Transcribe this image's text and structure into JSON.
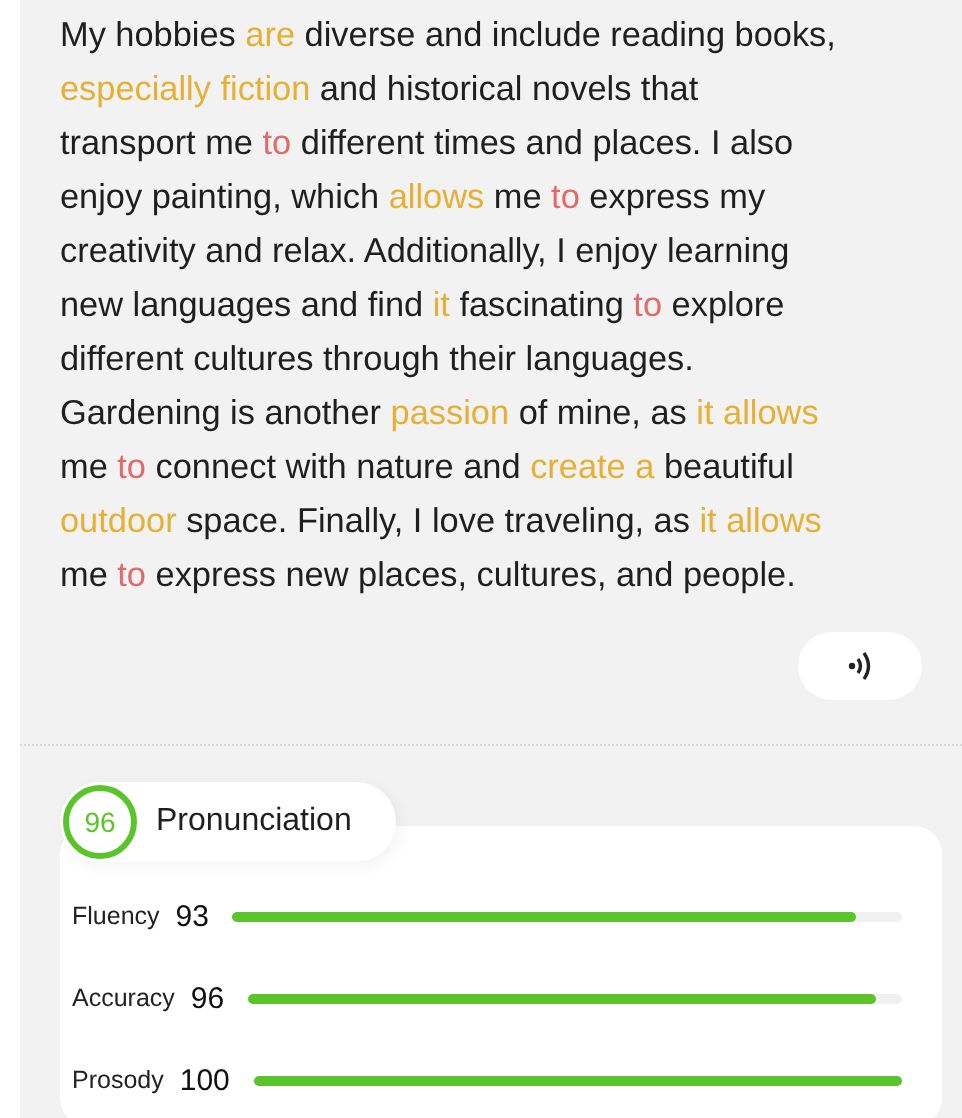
{
  "passage": {
    "lines": [
      [
        {
          "text": "My hobbies ",
          "kind": "plain"
        },
        {
          "text": "are",
          "kind": "minor"
        },
        {
          "text": " diverse and include reading books,",
          "kind": "plain"
        }
      ],
      [
        {
          "text": "especially fiction",
          "kind": "minor"
        },
        {
          "text": " and historical novels that",
          "kind": "plain"
        }
      ],
      [
        {
          "text": "transport me ",
          "kind": "plain"
        },
        {
          "text": "to",
          "kind": "major"
        },
        {
          "text": " different times and places. I also",
          "kind": "plain"
        }
      ],
      [
        {
          "text": "enjoy painting, which ",
          "kind": "plain"
        },
        {
          "text": "allows",
          "kind": "minor"
        },
        {
          "text": " me ",
          "kind": "plain"
        },
        {
          "text": "to",
          "kind": "major"
        },
        {
          "text": " express my",
          "kind": "plain"
        }
      ],
      [
        {
          "text": "creativity and relax. Additionally, I enjoy learning",
          "kind": "plain"
        }
      ],
      [
        {
          "text": "new languages and find ",
          "kind": "plain"
        },
        {
          "text": "it",
          "kind": "minor"
        },
        {
          "text": " fascinating ",
          "kind": "plain"
        },
        {
          "text": "to",
          "kind": "major"
        },
        {
          "text": " explore",
          "kind": "plain"
        }
      ],
      [
        {
          "text": "different cultures through their languages.",
          "kind": "plain"
        }
      ],
      [
        {
          "text": "Gardening is another ",
          "kind": "plain"
        },
        {
          "text": "passion",
          "kind": "minor"
        },
        {
          "text": " of mine, as ",
          "kind": "plain"
        },
        {
          "text": "it allows",
          "kind": "minor"
        }
      ],
      [
        {
          "text": "me ",
          "kind": "plain"
        },
        {
          "text": "to",
          "kind": "major"
        },
        {
          "text": " connect with nature and ",
          "kind": "plain"
        },
        {
          "text": "create a",
          "kind": "minor"
        },
        {
          "text": " beautiful",
          "kind": "plain"
        }
      ],
      [
        {
          "text": "outdoor",
          "kind": "minor"
        },
        {
          "text": " space. Finally, I love traveling, as ",
          "kind": "plain"
        },
        {
          "text": "it allows",
          "kind": "minor"
        }
      ],
      [
        {
          "text": "me ",
          "kind": "plain"
        },
        {
          "text": "to",
          "kind": "major"
        },
        {
          "text": " express new places, cultures, and people.",
          "kind": "plain"
        }
      ]
    ]
  },
  "score": {
    "value": "96",
    "title": "Pronunciation"
  },
  "metrics": [
    {
      "label": "Fluency",
      "value": "93",
      "level": 0.93
    },
    {
      "label": "Accuracy",
      "value": "96",
      "level": 0.96
    },
    {
      "label": "Prosody",
      "value": "100",
      "level": 1.0
    }
  ]
}
